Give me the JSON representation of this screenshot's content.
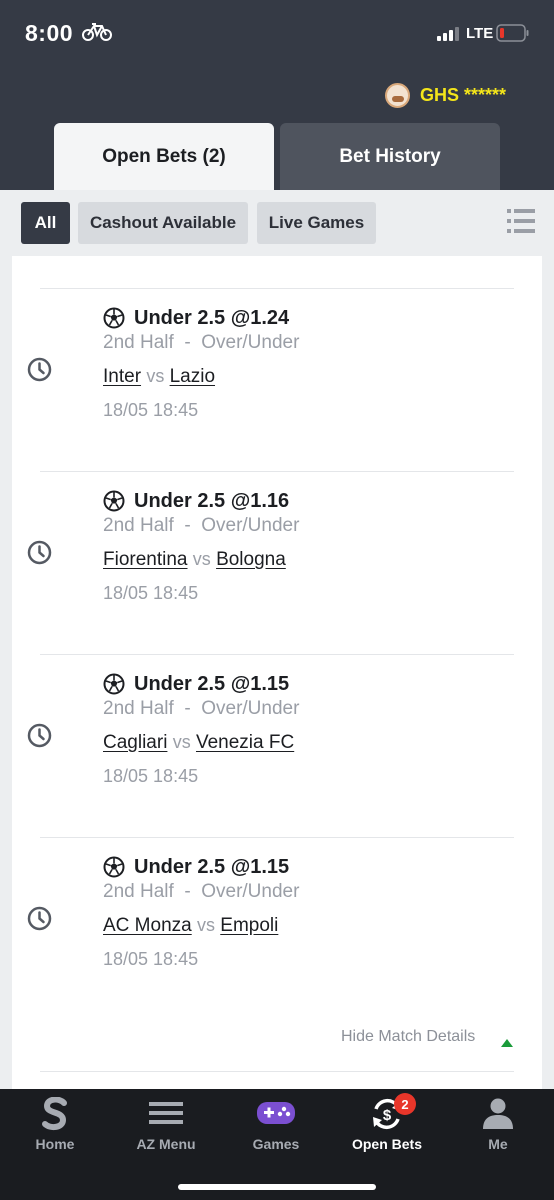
{
  "status_bar": {
    "time": "8:00",
    "network": "LTE"
  },
  "header": {
    "balance": "GHS ******"
  },
  "tabs": [
    {
      "label": "Open Bets (2)",
      "active": true
    },
    {
      "label": "Bet History",
      "active": false
    }
  ],
  "filters": [
    {
      "label": "All",
      "active": true
    },
    {
      "label": "Cashout Available",
      "active": false
    },
    {
      "label": "Live Games",
      "active": false
    }
  ],
  "bets": [
    {
      "selection": "Under 2.5 @1.24",
      "period": "2nd Half",
      "separator": "-",
      "market": "Over/Under",
      "home": "Inter",
      "vs": "vs",
      "away": "Lazio",
      "datetime": "18/05 18:45"
    },
    {
      "selection": "Under 2.5 @1.16",
      "period": "2nd Half",
      "separator": "-",
      "market": "Over/Under",
      "home": "Fiorentina",
      "vs": "vs",
      "away": "Bologna",
      "datetime": "18/05 18:45"
    },
    {
      "selection": "Under 2.5 @1.15",
      "period": "2nd Half",
      "separator": "-",
      "market": "Over/Under",
      "home": "Cagliari",
      "vs": "vs",
      "away": "Venezia FC",
      "datetime": "18/05 18:45"
    },
    {
      "selection": "Under 2.5 @1.15",
      "period": "2nd Half",
      "separator": "-",
      "market": "Over/Under",
      "home": "AC Monza",
      "vs": "vs",
      "away": "Empoli",
      "datetime": "18/05 18:45"
    }
  ],
  "details_toggle": "Hide Match Details",
  "bottom_nav": [
    {
      "label": "Home",
      "icon": "sportybet-logo-icon"
    },
    {
      "label": "AZ Menu",
      "icon": "hamburger-menu-icon"
    },
    {
      "label": "Games",
      "icon": "gamepad-icon"
    },
    {
      "label": "Open Bets",
      "icon": "open-bets-icon",
      "badge": "2",
      "active": true
    },
    {
      "label": "Me",
      "icon": "user-icon"
    }
  ],
  "colors": {
    "header_bg": "#353a45",
    "balance": "#f4e51a",
    "badge": "#e8362a",
    "caret": "#1a9b3a",
    "nav_bg": "#1a1c20"
  }
}
